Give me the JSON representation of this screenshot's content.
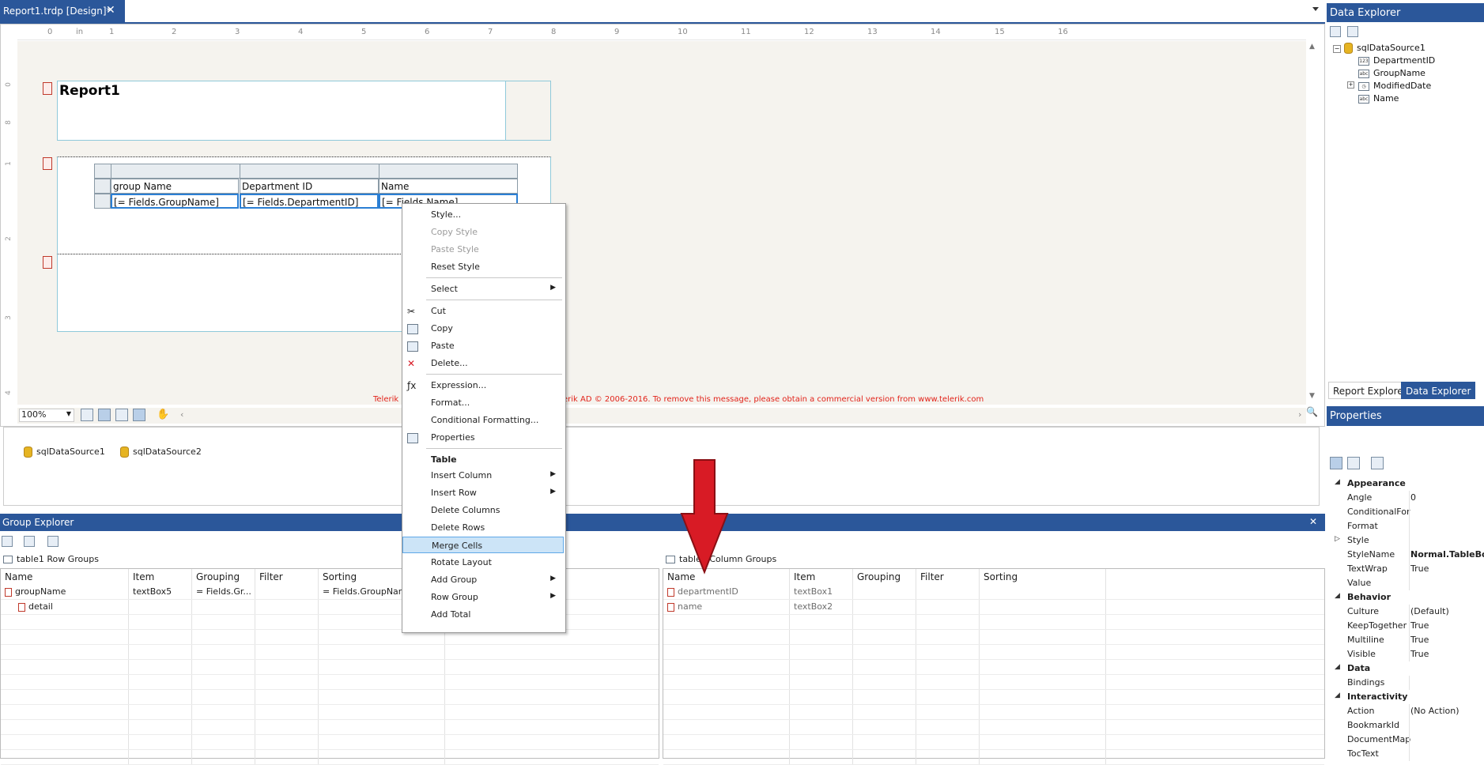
{
  "tab": {
    "title": "Report1.trdp [Design]*",
    "close": "✕"
  },
  "ruler": {
    "ticks": [
      "0",
      "in",
      "1",
      "2",
      "3",
      "4",
      "5",
      "6",
      "7",
      "8",
      "9",
      "10",
      "11",
      "12",
      "13",
      "14",
      "15",
      "16"
    ],
    "left_ticks": [
      "0",
      "8",
      "1",
      "2",
      "3",
      "4"
    ]
  },
  "report": {
    "title": "Report1"
  },
  "table": {
    "headers": [
      "group Name",
      "Department ID",
      "Name"
    ],
    "cells": [
      "[= Fields.GroupName]",
      "[= Fields.DepartmentID]",
      "[= Fields.Name]"
    ]
  },
  "watermark": {
    "part_a": "Telerik",
    "part_b": "erik AD © 2006-2016. To remove this message, please obtain a commercial version from www.telerik.com"
  },
  "zoom": {
    "value": "100%"
  },
  "datasources": [
    "sqlDataSource1",
    "sqlDataSource2"
  ],
  "context_menu": {
    "items": [
      {
        "label": "Style...",
        "disabled": false
      },
      {
        "label": "Copy Style",
        "disabled": true
      },
      {
        "label": "Paste Style",
        "disabled": true
      },
      {
        "label": "Reset Style",
        "disabled": false
      },
      {
        "label": "Select",
        "submenu": true
      },
      {
        "label": "Cut",
        "icon": "✂"
      },
      {
        "label": "Copy"
      },
      {
        "label": "Paste"
      },
      {
        "label": "Delete...",
        "icon": "✕"
      },
      {
        "label": "Expression...",
        "icon": "ƒx"
      },
      {
        "label": "Format..."
      },
      {
        "label": "Conditional Formatting..."
      },
      {
        "label": "Properties"
      },
      {
        "label": "Table",
        "bold": true
      },
      {
        "label": "Insert Column",
        "submenu": true
      },
      {
        "label": "Insert Row",
        "submenu": true
      },
      {
        "label": "Delete Columns"
      },
      {
        "label": "Delete Rows"
      },
      {
        "label": "Merge Cells",
        "highlighted": true
      },
      {
        "label": "Rotate Layout"
      },
      {
        "label": "Add Group",
        "submenu": true
      },
      {
        "label": "Row Group",
        "submenu": true
      },
      {
        "label": "Add Total"
      }
    ]
  },
  "group_explorer": {
    "title": "Group Explorer",
    "close": "✕",
    "row_groups": {
      "title": "table1 Row Groups",
      "columns": [
        "Name",
        "Item",
        "Grouping",
        "Filter",
        "Sorting"
      ],
      "rows": [
        [
          "groupName",
          "textBox5",
          "= Fields.Gr...",
          "",
          "= Fields.GroupName"
        ],
        [
          "detail",
          "",
          "",
          "",
          ""
        ]
      ]
    },
    "column_groups": {
      "title": "table1 Column Groups",
      "columns": [
        "Name",
        "Item",
        "Grouping",
        "Filter",
        "Sorting"
      ],
      "rows": [
        [
          "departmentID",
          "textBox1",
          "",
          "",
          ""
        ],
        [
          "name",
          "textBox2",
          "",
          "",
          ""
        ]
      ]
    }
  },
  "data_explorer": {
    "title": "Data Explorer",
    "source": "sqlDataSource1",
    "fields": [
      {
        "name": "DepartmentID",
        "type": "123"
      },
      {
        "name": "GroupName",
        "type": "abc"
      },
      {
        "name": "ModifiedDate",
        "type": "clock"
      },
      {
        "name": "Name",
        "type": "abc"
      }
    ],
    "tabs": [
      "Report Explorer",
      "Data Explorer"
    ]
  },
  "properties": {
    "title": "Properties",
    "rows": [
      {
        "cat": "Appearance"
      },
      {
        "name": "Angle",
        "value": "0"
      },
      {
        "name": "ConditionalFor",
        "value": ""
      },
      {
        "name": "Format",
        "value": ""
      },
      {
        "name": "Style",
        "value": "",
        "expand": true
      },
      {
        "name": "StyleName",
        "value": "Normal.TableBody",
        "bold": true
      },
      {
        "name": "TextWrap",
        "value": "True"
      },
      {
        "name": "Value",
        "value": ""
      },
      {
        "cat": "Behavior"
      },
      {
        "name": "Culture",
        "value": "(Default)"
      },
      {
        "name": "KeepTogether",
        "value": "True"
      },
      {
        "name": "Multiline",
        "value": "True"
      },
      {
        "name": "Visible",
        "value": "True"
      },
      {
        "cat": "Data"
      },
      {
        "name": "Bindings",
        "value": ""
      },
      {
        "cat": "Interactivity"
      },
      {
        "name": "Action",
        "value": "(No Action)"
      },
      {
        "name": "BookmarkId",
        "value": ""
      },
      {
        "name": "DocumentMap",
        "value": ""
      },
      {
        "name": "TocText",
        "value": ""
      }
    ]
  },
  "colors": {
    "accent": "#2b579a",
    "menu_highlight": "#cce4f7",
    "arrow": "#d81b25"
  }
}
